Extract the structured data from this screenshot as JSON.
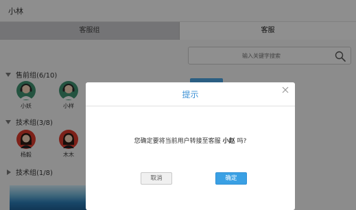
{
  "app": {
    "title": "小林"
  },
  "tabs": [
    {
      "label": "客服组",
      "active": false
    },
    {
      "label": "客服",
      "active": true
    }
  ],
  "search": {
    "placeholder": "输入关键字搜索",
    "icon": "search-icon"
  },
  "groups": [
    {
      "label": "售前组(6/10)",
      "expanded": true,
      "members": [
        {
          "name": "小妖",
          "avatar": "support-agent-avatar"
        },
        {
          "name": "小样",
          "avatar": "support-agent-avatar"
        }
      ]
    },
    {
      "label": "技术组(3/8)",
      "expanded": true,
      "members": [
        {
          "name": "杨毅",
          "avatar": "female-agent-avatar"
        },
        {
          "name": "木木",
          "avatar": "female-agent-avatar"
        }
      ]
    },
    {
      "label": "技术组(1/8)",
      "expanded": false,
      "members": []
    }
  ],
  "dialog": {
    "title": "提示",
    "message_prefix": "您确定要将当前用户转接至客服",
    "target_name": "小赵",
    "message_suffix": "吗?",
    "cancel_label": "取消",
    "confirm_label": "确定"
  },
  "colors": {
    "accent": "#3a8fd4",
    "confirm_button": "#3aa0e4",
    "overlay": "rgba(0,0,0,0.42)",
    "avatar_green": "#3f8f6f",
    "avatar_red": "#d83a2c"
  }
}
